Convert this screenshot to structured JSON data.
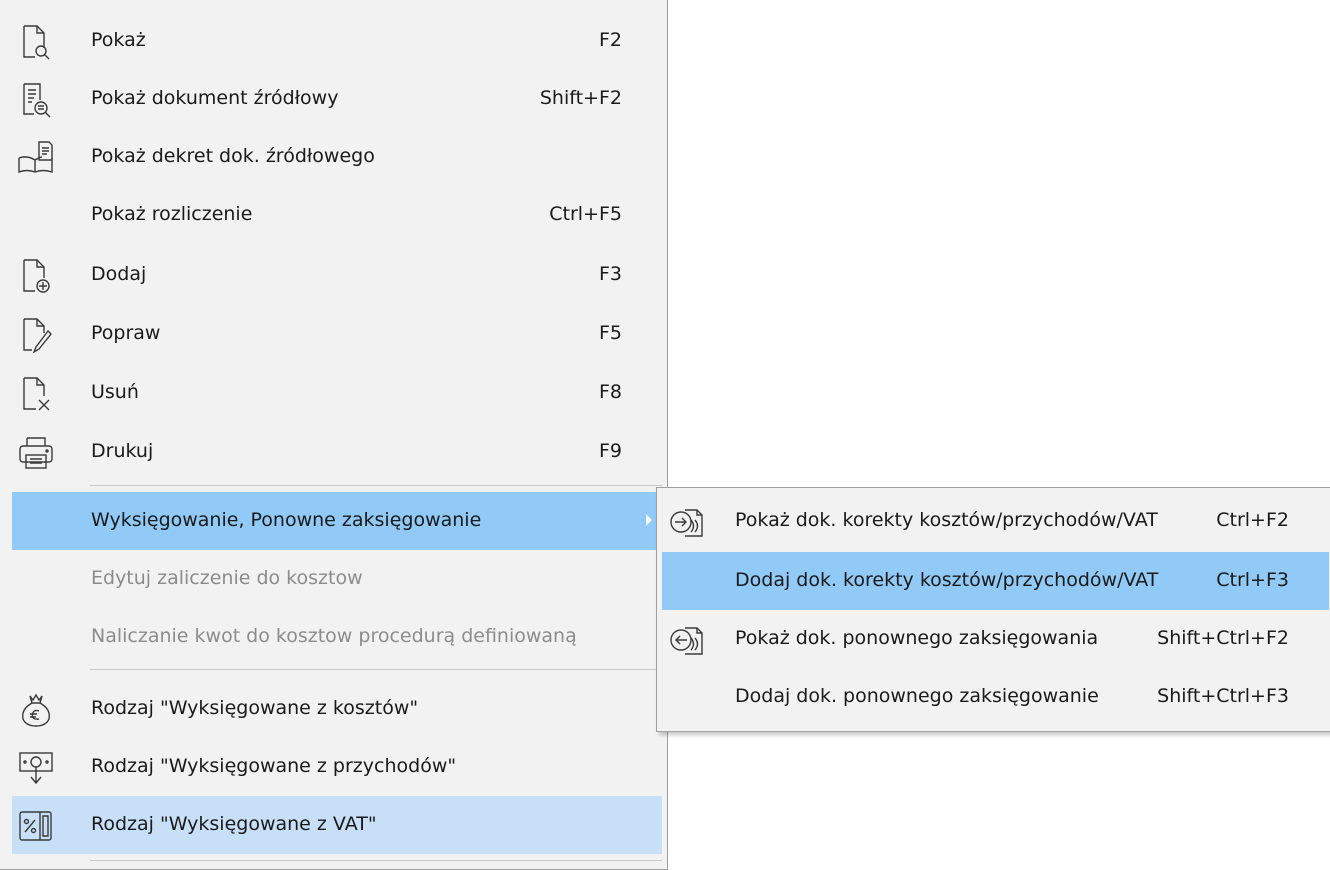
{
  "main_menu": {
    "items": [
      {
        "label": "Pokaż",
        "shortcut": "F2",
        "icon": "document-search-icon"
      },
      {
        "label": "Pokaż dokument źródłowy",
        "shortcut": "Shift+F2",
        "icon": "document-list-search-icon"
      },
      {
        "label": "Pokaż dekret dok. źródłowego",
        "shortcut": "",
        "icon": "book-document-icon"
      },
      {
        "label": "Pokaż rozliczenie",
        "shortcut": "Ctrl+F5",
        "icon": ""
      },
      {
        "label": "Dodaj",
        "shortcut": "F3",
        "icon": "document-add-icon"
      },
      {
        "label": "Popraw",
        "shortcut": "F5",
        "icon": "document-edit-icon"
      },
      {
        "label": "Usuń",
        "shortcut": "F8",
        "icon": "document-delete-icon"
      },
      {
        "label": "Drukuj",
        "shortcut": "F9",
        "icon": "printer-icon"
      },
      {
        "label": "Wyksięgowanie, Ponowne zaksięgowanie",
        "shortcut": "",
        "icon": "",
        "submenu_arrow": "chevron-right-icon",
        "state": "highlighted"
      },
      {
        "label": "Edytuj zaliczenie do kosztow",
        "shortcut": "",
        "icon": "",
        "state": "disabled"
      },
      {
        "label": "Naliczanie kwot do kosztow procedurą definiowaną",
        "shortcut": "",
        "icon": "",
        "state": "disabled"
      },
      {
        "label": "Rodzaj \"Wyksięgowane z kosztów\"",
        "shortcut": "",
        "icon": "euro-money-bag-icon"
      },
      {
        "label": "Rodzaj \"Wyksięgowane z przychodów\"",
        "shortcut": "",
        "icon": "banknote-down-arrow-icon"
      },
      {
        "label": "Rodzaj \"Wyksięgowane z VAT\"",
        "shortcut": "",
        "icon": "percent-document-icon",
        "state": "hovered"
      }
    ]
  },
  "submenu": {
    "items": [
      {
        "label": "Pokaż dok. korekty kosztów/przychodów/VAT",
        "shortcut": "Ctrl+F2",
        "icon": "arrow-right-document-icon"
      },
      {
        "label": "Dodaj dok. korekty kosztów/przychodów/VAT",
        "shortcut": "Ctrl+F3",
        "icon": "",
        "state": "highlighted"
      },
      {
        "label": "Pokaż dok. ponownego zaksięgowania",
        "shortcut": "Shift+Ctrl+F2",
        "icon": "arrow-left-document-icon"
      },
      {
        "label": "Dodaj dok. ponownego zaksięgowanie",
        "shortcut": "Shift+Ctrl+F3",
        "icon": ""
      }
    ]
  },
  "colors": {
    "menu_background": "#f2f2f2",
    "highlight": "#91c9f7",
    "hover_light": "#c7e0f7",
    "disabled_text": "#8c8c8c",
    "separator": "#c8c8c8"
  }
}
